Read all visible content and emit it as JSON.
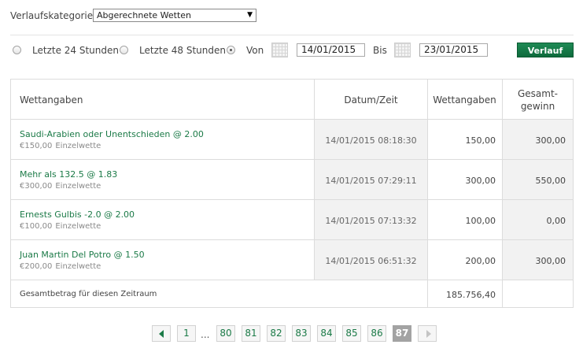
{
  "category": {
    "label": "Verlaufskategorie",
    "selected": "Abgerechnete Wetten"
  },
  "filter": {
    "opt_24h": "Letzte 24 Stunden",
    "opt_48h": "Letzte 48 Stunden",
    "opt_from": "Von",
    "from_date": "14/01/2015",
    "to_label": "Bis",
    "to_date": "23/01/2015",
    "selected_option": "opt_from",
    "button": "Verlauf"
  },
  "table": {
    "headers": {
      "bets": "Wettangaben",
      "datetime": "Datum/Zeit",
      "stake": "Wettangaben",
      "total_win_1": "Gesamt-",
      "total_win_2": "gewinn"
    },
    "rows": [
      {
        "selection": "Saudi-Arabien oder Unentschieden @  2.00",
        "stake_amount": "€150,00",
        "bet_type": "Einzelwette",
        "datetime": "14/01/2015 08:18:30",
        "stake": "150,00",
        "winnings": "300,00"
      },
      {
        "selection": "Mehr als 132.5 @  1.83",
        "stake_amount": "€300,00",
        "bet_type": "Einzelwette",
        "datetime": "14/01/2015 07:29:11",
        "stake": "300,00",
        "winnings": "550,00"
      },
      {
        "selection": "Ernests Gulbis -2.0 @  2.00",
        "stake_amount": "€100,00",
        "bet_type": "Einzelwette",
        "datetime": "14/01/2015 07:13:32",
        "stake": "100,00",
        "winnings": "0,00"
      },
      {
        "selection": "Juan Martin Del Potro @  1.50",
        "stake_amount": "€200,00",
        "bet_type": "Einzelwette",
        "datetime": "14/01/2015 06:51:32",
        "stake": "200,00",
        "winnings": "300,00"
      }
    ],
    "footer": {
      "label": "Gesamtbetrag für diesen Zeitraum",
      "total": "185.756,40"
    }
  },
  "pagination": {
    "first": "1",
    "ellipsis": "...",
    "pages": [
      "80",
      "81",
      "82",
      "83",
      "84",
      "85",
      "86"
    ],
    "current": "87"
  },
  "colors": {
    "accent_green": "#1b7a47",
    "button_green": "#0e6a3c",
    "active_page": "#a3a3a3"
  },
  "icons": {
    "prev": "chevron-left-icon",
    "next": "chevron-right-icon",
    "calendar": "calendar-icon",
    "dropdown": "dropdown-arrow-icon"
  }
}
